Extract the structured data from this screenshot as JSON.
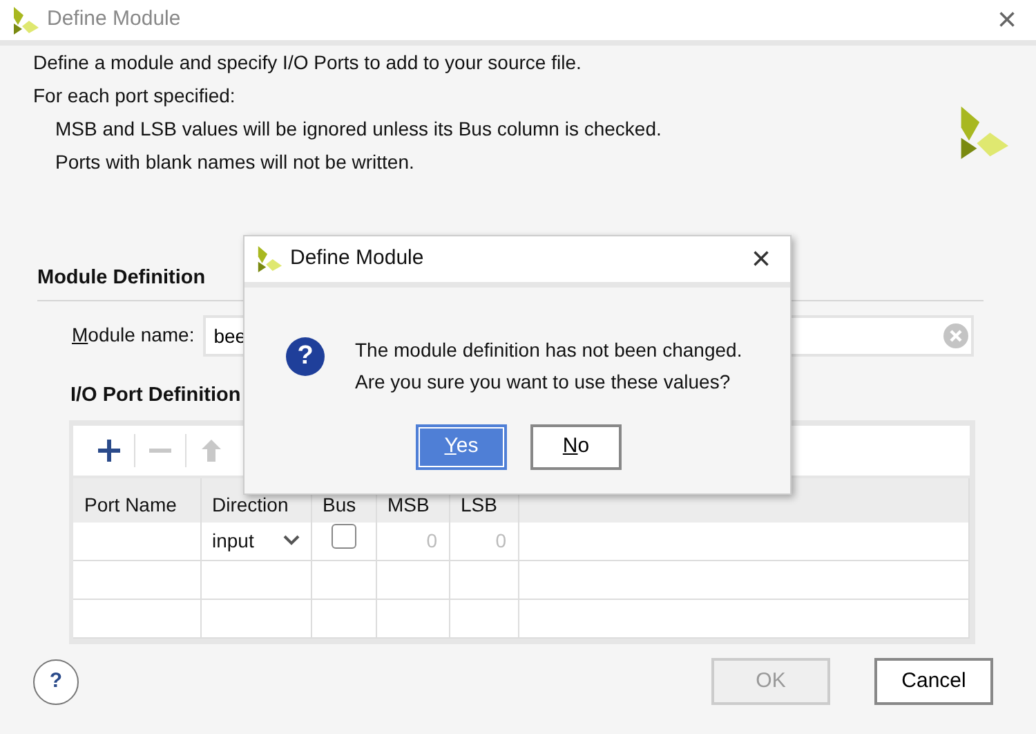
{
  "window": {
    "title": "Define Module",
    "close": "×"
  },
  "intro": [
    "Define a module and specify I/O Ports to add to your source file.",
    "For each port specified:"
  ],
  "intro_bullets": [
    "MSB and LSB values will be ignored unless its Bus column is checked.",
    "Ports with blank names will not be written."
  ],
  "module_definition": {
    "heading": "Module Definition",
    "label": "Module name:",
    "value": "bee"
  },
  "io_ports": {
    "heading": "I/O Port Definition",
    "toolbar": [
      {
        "kind": "add",
        "disabled": false
      },
      {
        "kind": "remove",
        "disabled": true
      },
      {
        "kind": "up",
        "disabled": true
      }
    ],
    "columns": [
      "Port Name",
      "Direction",
      "Bus",
      "MSB",
      "LSB"
    ],
    "rows": [
      {
        "direction": "input",
        "bus": false,
        "msb": "0",
        "lsb": "0"
      }
    ]
  },
  "help": "?",
  "buttons": [
    {
      "label": "OK",
      "disabled": true
    },
    {
      "label": "Cancel",
      "disabled": false
    }
  ],
  "popup": {
    "title": "Define Module",
    "close": "×",
    "icon": "?",
    "message": [
      "The module definition has not been changed.",
      "Are you sure you want to use these values?"
    ],
    "buttons": [
      {
        "label": "Yes",
        "selected": true
      },
      {
        "label": "No",
        "selected": false
      }
    ]
  }
}
